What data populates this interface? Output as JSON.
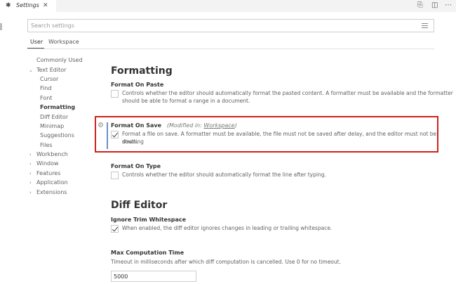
{
  "tab": {
    "icon": "settings-gear-icon",
    "title": "Settings",
    "close": "✕"
  },
  "toolbar": {
    "open_json_icon": "open-json-icon",
    "split_icon": "split-editor-icon",
    "more_icon": "more-actions-icon"
  },
  "search": {
    "placeholder": "Search settings"
  },
  "scope_tabs": {
    "user": "User",
    "workspace": "Workspace"
  },
  "toc": {
    "commonly_used": "Commonly Used",
    "text_editor": "Text Editor",
    "cursor": "Cursor",
    "find": "Find",
    "font": "Font",
    "formatting": "Formatting",
    "diff_editor": "Diff Editor",
    "minimap": "Minimap",
    "suggestions": "Suggestions",
    "files": "Files",
    "workbench": "Workbench",
    "window": "Window",
    "features": "Features",
    "application": "Application",
    "extensions": "Extensions"
  },
  "formatting": {
    "title": "Formatting",
    "format_on_paste": {
      "label": "Format On Paste",
      "checked": false,
      "desc1": "Controls whether the editor should automatically format the pasted content. A formatter must be available and the formatter",
      "desc2": "should be able to format a range in a document."
    },
    "format_on_save": {
      "label": "Format On Save",
      "modified_prefix": "(Modified in: ",
      "modified_scope": "Workspace",
      "modified_suffix": ")",
      "checked": true,
      "desc1": "Format a file on save. A formatter must be available, the file must not be saved after delay, and the editor must not be shutting",
      "desc2": "down."
    },
    "format_on_type": {
      "label": "Format On Type",
      "checked": false,
      "desc": "Controls whether the editor should automatically format the line after typing."
    }
  },
  "diff_editor": {
    "title": "Diff Editor",
    "ignore_trim_whitespace": {
      "label": "Ignore Trim Whitespace",
      "checked": true,
      "desc": "When enabled, the diff editor ignores changes in leading or trailing whitespace."
    },
    "max_computation_time": {
      "label": "Max Computation Time",
      "desc": "Timeout in milliseconds after which diff computation is cancelled. Use 0 for no timeout.",
      "value": "5000"
    }
  },
  "colors": {
    "highlight": "#d0211c",
    "modified_bar": "#6c8fc7"
  }
}
